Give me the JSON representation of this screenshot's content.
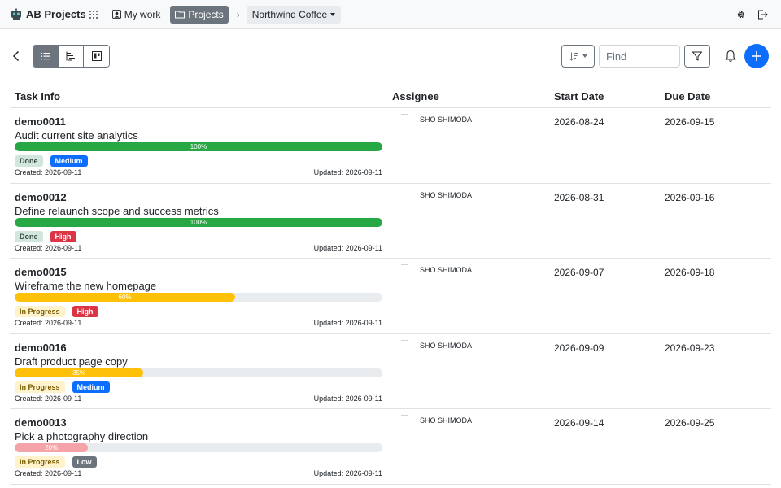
{
  "nav": {
    "brand": "AB Projects",
    "my_work": "My work",
    "projects": "Projects",
    "current_project": "Northwind Coffee",
    "settings_icon": "gear-icon",
    "logout_icon": "logout-icon"
  },
  "toolbar": {
    "find_placeholder": "Find",
    "views": [
      "list-view",
      "gantt-view",
      "board-view"
    ],
    "active_view": "list-view"
  },
  "table": {
    "columns": {
      "task_info": "Task Info",
      "assignee": "Assignee",
      "start_date": "Start Date",
      "due_date": "Due Date"
    },
    "rows": [
      {
        "id": "demo0011",
        "title": "Audit current site analytics",
        "progress": 100,
        "progress_label": "100%",
        "progress_color": "#28a745",
        "status": "Done",
        "priority": "Medium",
        "created": "Created: 2026-09-11",
        "updated": "Updated: 2026-09-11",
        "assignee": "SHO SHIMODA",
        "start": "2026-08-24",
        "due": "2026-09-15"
      },
      {
        "id": "demo0012",
        "title": "Define relaunch scope and success metrics",
        "progress": 100,
        "progress_label": "100%",
        "progress_color": "#28a745",
        "status": "Done",
        "priority": "High",
        "created": "Created: 2026-09-11",
        "updated": "Updated: 2026-09-11",
        "assignee": "SHO SHIMODA",
        "start": "2026-08-31",
        "due": "2026-09-16"
      },
      {
        "id": "demo0015",
        "title": "Wireframe the new homepage",
        "progress": 60,
        "progress_label": "60%",
        "progress_color": "#ffc107",
        "status": "In Progress",
        "priority": "High",
        "created": "Created: 2026-09-11",
        "updated": "Updated: 2026-09-11",
        "assignee": "SHO SHIMODA",
        "start": "2026-09-07",
        "due": "2026-09-18"
      },
      {
        "id": "demo0016",
        "title": "Draft product page copy",
        "progress": 35,
        "progress_label": "35%",
        "progress_color": "#ffc107",
        "status": "In Progress",
        "priority": "Medium",
        "created": "Created: 2026-09-11",
        "updated": "Updated: 2026-09-11",
        "assignee": "SHO SHIMODA",
        "start": "2026-09-09",
        "due": "2026-09-23"
      },
      {
        "id": "demo0013",
        "title": "Pick a photography direction",
        "progress": 20,
        "progress_label": "20%",
        "progress_color": "#f4a3a8",
        "status": "In Progress",
        "priority": "Low",
        "created": "Created: 2026-09-11",
        "updated": "Updated: 2026-09-11",
        "assignee": "SHO SHIMODA",
        "start": "2026-09-14",
        "due": "2026-09-25"
      }
    ]
  },
  "badge_colors": {
    "Done": {
      "bg": "#d1e7dd",
      "fg": "#3c4a44"
    },
    "In Progress": {
      "bg": "#fff3cd",
      "fg": "#7a5c00"
    },
    "High": {
      "bg": "#dc3545",
      "fg": "#ffffff"
    },
    "Medium": {
      "bg": "#0d6efd",
      "fg": "#ffffff"
    },
    "Low": {
      "bg": "#6c757d",
      "fg": "#ffffff"
    }
  }
}
